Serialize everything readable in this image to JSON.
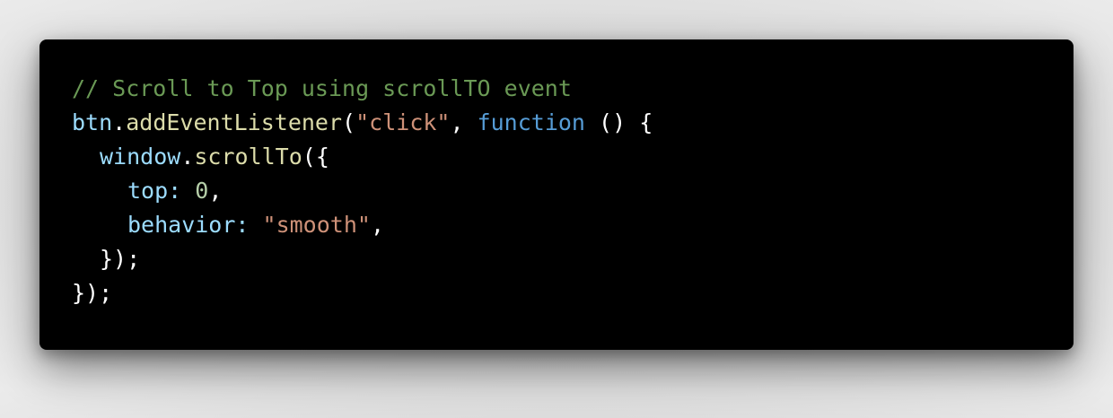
{
  "code": {
    "line1": {
      "comment": "// Scroll to Top using scrollTO event"
    },
    "line2": {
      "obj": "btn",
      "dot": ".",
      "method": "addEventListener",
      "open": "(",
      "event": "\"click\"",
      "comma": ", ",
      "keyword": "function",
      "rest": " () {"
    },
    "line3": {
      "obj": "window",
      "dot": ".",
      "method": "scrollTo",
      "open": "({"
    },
    "line4": {
      "key": "top",
      "colon": ": ",
      "value": "0",
      "comma": ","
    },
    "line5": {
      "key": "behavior",
      "colon": ": ",
      "value": "\"smooth\"",
      "comma": ","
    },
    "line6": {
      "text": "});"
    },
    "line7": {
      "text": "});"
    }
  },
  "colors": {
    "background": "#000000",
    "comment": "#6a9955",
    "variable": "#9cdcfe",
    "function": "#dcdcaa",
    "string": "#ce9178",
    "keyword": "#569cd6",
    "number": "#b5cea8",
    "punctuation": "#ffffff"
  }
}
